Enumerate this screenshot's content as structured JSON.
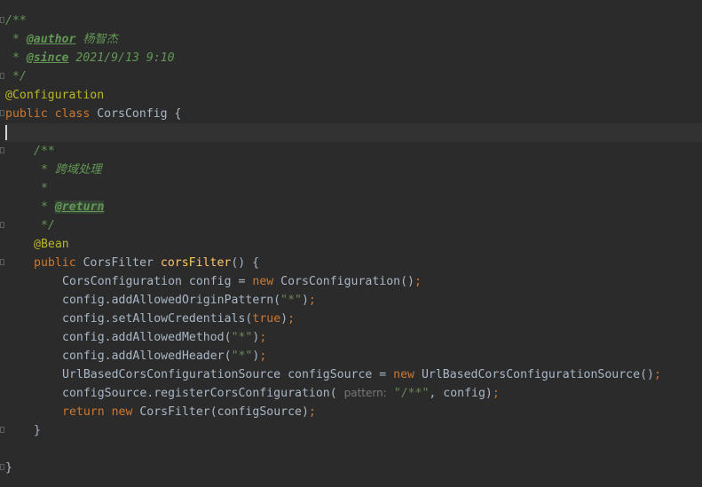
{
  "editor": {
    "colors": {
      "background": "#2b2b2b",
      "current_line": "#323232",
      "keyword": "#cc7832",
      "doc_comment": "#629755",
      "annotation": "#bbb529",
      "method_declaration": "#ffc66d",
      "string": "#6a8759",
      "identifier": "#a9b7c6",
      "param_hint": "#787878"
    },
    "icons": [
      "fold-marker-icon",
      "text-caret"
    ],
    "lines": {
      "l1": {
        "open": "/**"
      },
      "l2": {
        "star": " * ",
        "tag": "@author",
        "value": "杨智杰"
      },
      "l3": {
        "star": " * ",
        "tag": "@since",
        "value": "2021/9/13 9:10"
      },
      "l4": {
        "close": " */"
      },
      "l5": {
        "annotation": "@Configuration"
      },
      "l6": {
        "kw": "public class ",
        "name": "CorsConfig {"
      },
      "l8": {
        "open": "/**"
      },
      "l9": {
        "star": " * ",
        "text": "跨域处理"
      },
      "l10": {
        "star": " *"
      },
      "l11": {
        "star": " * ",
        "tag": "@return"
      },
      "l12": {
        "close": " */"
      },
      "l13": {
        "annotation": "@Bean"
      },
      "l14": {
        "kw": "public ",
        "type": "CorsFilter ",
        "method": "corsFilter",
        "rest": "() {"
      },
      "l15": {
        "a": "CorsConfiguration config = ",
        "kw": "new ",
        "b": "CorsConfiguration()",
        "semi": ";"
      },
      "l16": {
        "a": "config.addAllowedOriginPattern(",
        "str": "\"*\"",
        "b": ")",
        "semi": ";"
      },
      "l17": {
        "a": "config.setAllowCredentials(",
        "kw": "true",
        "b": ")",
        "semi": ";"
      },
      "l18": {
        "a": "config.addAllowedMethod(",
        "str": "\"*\"",
        "b": ")",
        "semi": ";"
      },
      "l19": {
        "a": "config.addAllowedHeader(",
        "str": "\"*\"",
        "b": ")",
        "semi": ";"
      },
      "l20": {
        "a": "UrlBasedCorsConfigurationSource configSource = ",
        "kw": "new ",
        "b": "UrlBasedCorsConfigurationSource()",
        "semi": ";"
      },
      "l21": {
        "a": "configSource.registerCorsConfiguration( ",
        "hint": "pattern:",
        "str": "\"/**\"",
        "b": ", config)",
        "semi": ";"
      },
      "l22": {
        "kw": "return ",
        "kw2": "new ",
        "b": "CorsFilter(configSource)",
        "semi": ";"
      },
      "l23": {
        "brace": "}"
      },
      "l25": {
        "brace": "}"
      }
    }
  }
}
